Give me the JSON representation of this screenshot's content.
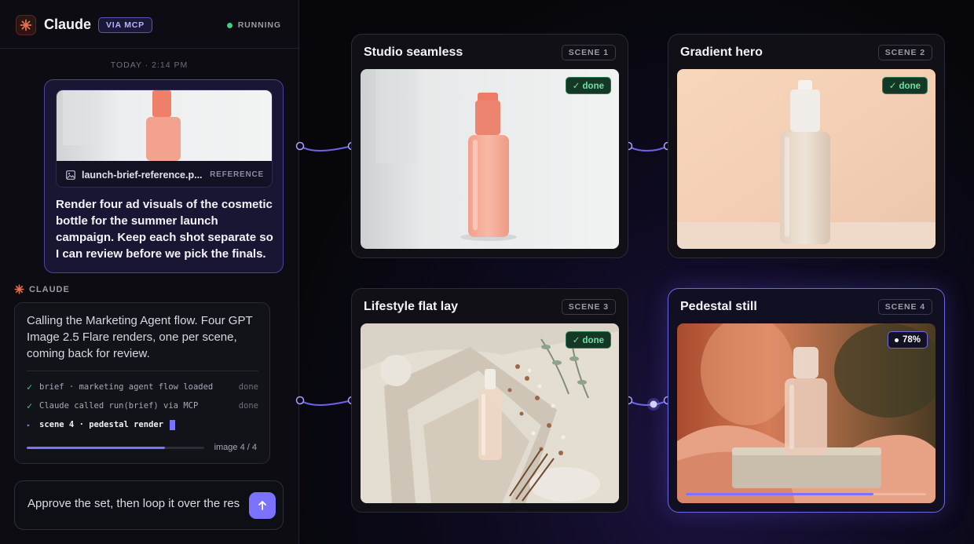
{
  "app": {
    "title": "Claude",
    "badge": "VIA MCP",
    "status": "RUNNING",
    "status_color": "#3fcf7f",
    "logo_icon": "claude-starburst"
  },
  "chat": {
    "timestamp": "TODAY · 2:14 PM",
    "user_message": {
      "attachment_name": "launch-brief-reference.p...",
      "attachment_tag": "REFERENCE",
      "attachment_icon": "image-icon",
      "text": "Render four ad visuals of the cosmetic bottle for the summer launch campaign. Keep each shot separate so I can review before we pick the finals."
    },
    "assistant": {
      "label": "CLAUDE",
      "text": "Calling the Marketing Agent flow. Four GPT Image 2.5 Flare renders, one per scene, coming back for review.",
      "log": [
        {
          "icon": "✓",
          "text": "brief · marketing agent flow loaded",
          "status": "done"
        },
        {
          "icon": "✓",
          "text": "Claude called run(brief) via MCP",
          "status": "done"
        },
        {
          "icon": "▸",
          "text": "scene 4 · pedestal render",
          "status": ""
        }
      ],
      "progress": 0.78,
      "progress_label": "image 4 / 4"
    },
    "composer": {
      "value": "Approve the set, then loop it over the res",
      "send_icon": "arrow-up-icon"
    }
  },
  "scenes": [
    {
      "title": "Studio seamless",
      "tag": "SCENE 1",
      "status": "done",
      "badge": "✓ done"
    },
    {
      "title": "Gradient hero",
      "tag": "SCENE 2",
      "status": "done",
      "badge": "✓ done"
    },
    {
      "title": "Lifestyle flat lay",
      "tag": "SCENE 3",
      "status": "done",
      "badge": "✓ done"
    },
    {
      "title": "Pedestal still",
      "tag": "SCENE 4",
      "status": "rendering",
      "badge": "78%",
      "progress": 0.78
    }
  ],
  "colors": {
    "accent": "#7b73ff",
    "done": "#6fe0a2",
    "background": "#07070b"
  }
}
